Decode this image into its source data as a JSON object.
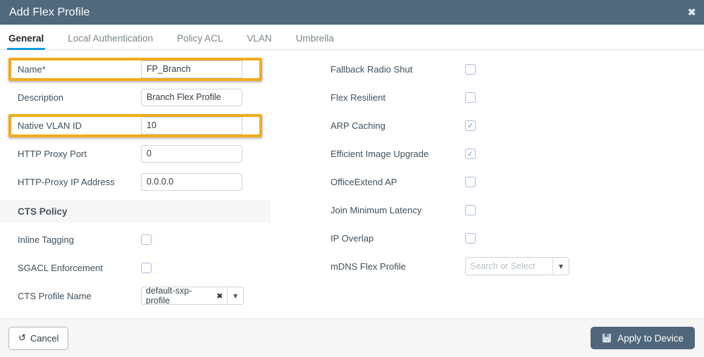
{
  "window": {
    "title": "Add Flex Profile",
    "close_icon": "close-icon",
    "header_color": "#51697d"
  },
  "tabs": {
    "active_index": 0,
    "accent_color": "#0d9ae0",
    "items": [
      {
        "label": "General"
      },
      {
        "label": "Local Authentication"
      },
      {
        "label": "Policy ACL"
      },
      {
        "label": "VLAN"
      },
      {
        "label": "Umbrella"
      }
    ]
  },
  "highlight": {
    "color": "#f0ab1e",
    "fields": [
      "Name*",
      "Native VLAN ID"
    ]
  },
  "left_column": {
    "fields": [
      {
        "label": "Name*",
        "value": "FP_Branch",
        "highlighted": true
      },
      {
        "label": "Description",
        "value": "Branch Flex Profile",
        "highlighted": false
      },
      {
        "label": "Native VLAN ID",
        "value": "10",
        "highlighted": true
      },
      {
        "label": "HTTP Proxy Port",
        "value": "0",
        "highlighted": false
      },
      {
        "label": "HTTP-Proxy IP Address",
        "value": "0.0.0.0",
        "highlighted": false
      }
    ],
    "section": {
      "title": "CTS Policy",
      "checkboxes": [
        {
          "label": "Inline Tagging",
          "checked": false
        },
        {
          "label": "SGACL Enforcement",
          "checked": false
        }
      ],
      "select": {
        "label": "CTS Profile Name",
        "value": "default-sxp-profile",
        "remove_icon": "close-icon",
        "caret_icon": "chevron-down-icon"
      }
    }
  },
  "right_column": {
    "checkboxes": [
      {
        "label": "Fallback Radio Shut",
        "checked": false
      },
      {
        "label": "Flex Resilient",
        "checked": false
      },
      {
        "label": "ARP Caching",
        "checked": true
      },
      {
        "label": "Efficient Image Upgrade",
        "checked": true
      },
      {
        "label": "OfficeExtend AP",
        "checked": false
      },
      {
        "label": "Join Minimum Latency",
        "checked": false
      },
      {
        "label": "IP Overlap",
        "checked": false
      }
    ],
    "select": {
      "label": "mDNS Flex Profile",
      "value": "",
      "placeholder": "Search or Select",
      "caret_icon": "chevron-down-icon"
    }
  },
  "footer": {
    "cancel_label": "Cancel",
    "cancel_icon": "undo-icon",
    "apply_label": "Apply to Device",
    "apply_icon": "save-icon",
    "apply_color": "#50677b"
  }
}
